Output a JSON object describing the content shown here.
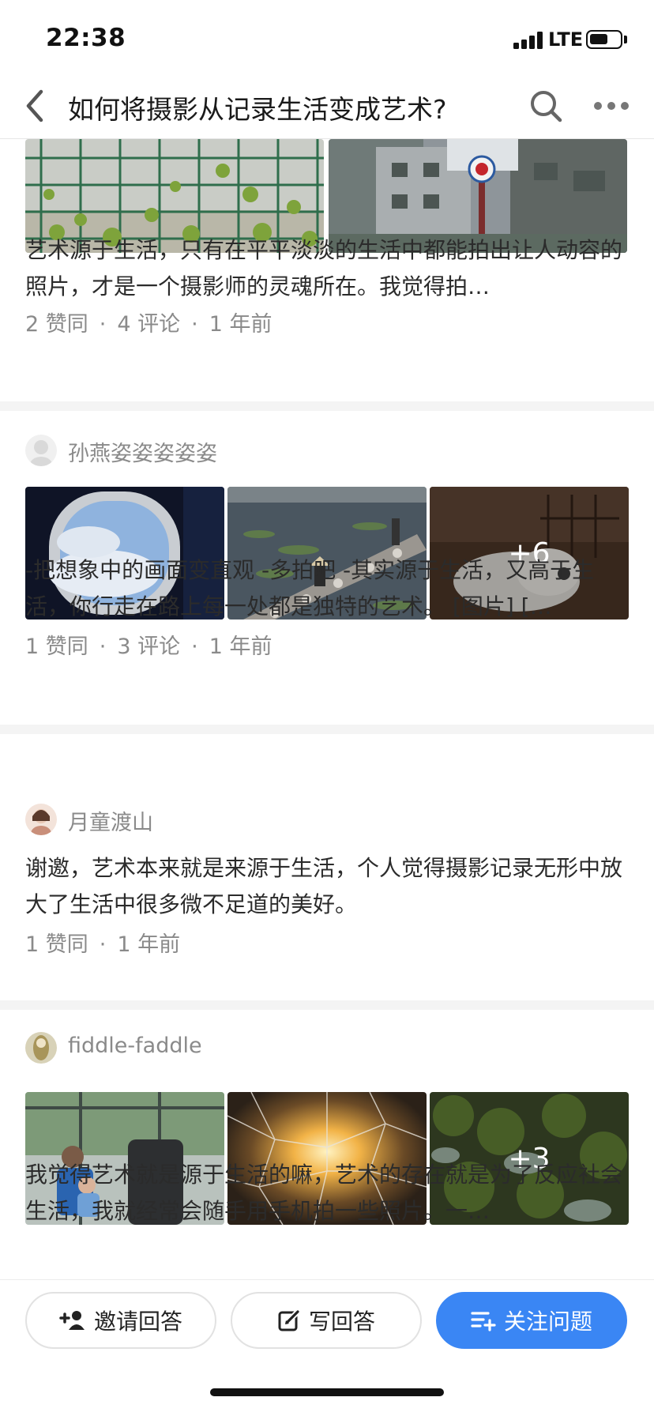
{
  "status_bar": {
    "time": "22:38",
    "network": "LTE",
    "battery_level": 0.6
  },
  "header": {
    "title": "如何将摄影从记录生活变成艺术?",
    "back_icon": "chevron-left-icon",
    "search_icon": "search-icon",
    "more_icon": "more-horizontal-icon"
  },
  "answers": [
    {
      "excerpt": "艺术源于生活，只有在平平淡淡的生活中都能拍出让人动容的照片，才是一个摄影师的灵魂所在。我觉得拍…",
      "upvotes": "2 赞同",
      "comments": "4 评论",
      "time": "1 年前",
      "separator": "·"
    },
    {
      "author": "孙燕姿姿姿姿姿",
      "more_images": "+6",
      "excerpt": "-把想象中的画面变直观 -多拍吧 -其实源于生活，又高于生活，你行走在路上每一处都是独特的艺术。 [图片] […",
      "upvotes": "1 赞同",
      "comments": "3 评论",
      "time": "1 年前",
      "separator": "·"
    },
    {
      "author": "月童渡山",
      "excerpt": "谢邀，艺术本来就是来源于生活，个人觉得摄影记录无形中放大了生活中很多微不足道的美好。",
      "upvotes": "1 赞同",
      "time": "1 年前",
      "separator": "·"
    },
    {
      "author": "fiddle-faddle",
      "more_images": "+3",
      "excerpt": "我觉得艺术就是源于生活的嘛，艺术的存在就是为了反应社会生活，我就经常会随手用手机拍一些照片。一…"
    }
  ],
  "bottom_bar": {
    "invite_label": "邀请回答",
    "write_label": "写回答",
    "follow_label": "关注问题",
    "primary_color": "#3a86f4"
  }
}
